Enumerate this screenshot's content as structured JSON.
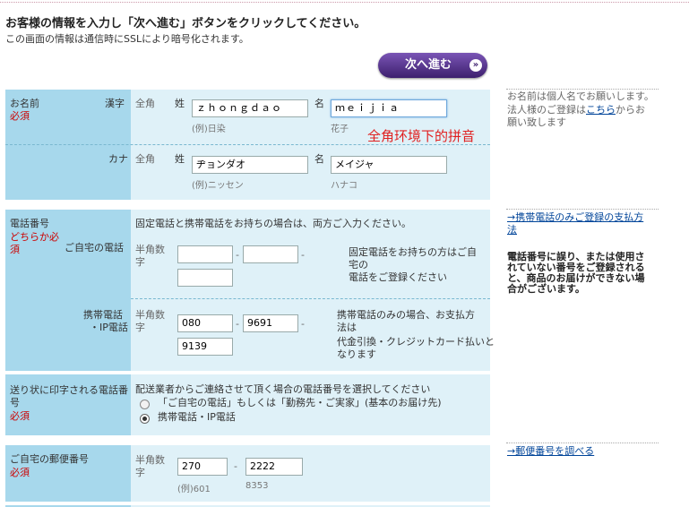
{
  "header": {
    "title": "お客様の情報を入力し「次へ進む」ボタンをクリックしてください。",
    "ssl_note": "この画面の情報は通信時にSSLにより暗号化されます。",
    "next_button": "次へ進む"
  },
  "name_section": {
    "label": "お名前",
    "required": "必須",
    "kanji": {
      "row_label": "漢字",
      "type_label": "全角",
      "sei_label": "姓",
      "sei_value": "ｚｈｏｎｇｄａｏ",
      "sei_example": "(例)日染",
      "mei_label": "名",
      "mei_value": "ｍｅｉｊｉａ",
      "mei_example": "花子"
    },
    "annotation": "全角环境下的拼音",
    "kana": {
      "row_label": "カナ",
      "type_label": "全角",
      "sei_label": "姓",
      "sei_value": "ヂョンダオ",
      "sei_example": "(例)ニッセン",
      "mei_label": "名",
      "mei_value": "メイジャ",
      "mei_example": "ハナコ"
    }
  },
  "name_note": {
    "line1": "お名前は個人名でお願いします。",
    "line2_prefix": "法人様のご登録は",
    "line2_link": "こちら",
    "line2_suffix": "からお",
    "line3": "願い致します"
  },
  "phone_section": {
    "label": "電話番号",
    "required_1": "どちらか必",
    "required_2": "須",
    "intro": "固定電話と携帯電話をお持ちの場合は、両方ご入力ください。",
    "home": {
      "label": "ご自宅の電話",
      "type_1": "半角数",
      "type_2": "字",
      "part1": "",
      "part2": "",
      "part3": "",
      "note_1": "固定電話をお持ちの方はご自",
      "note_2": "宅の",
      "note_3": "電話をご登録ください"
    },
    "mobile": {
      "label_1": "携帯電話",
      "label_2": "・IP電話",
      "type_1": "半角数",
      "type_2": "字",
      "part1": "080",
      "part2": "9691",
      "part3": "9139",
      "note_1": "携帯電話のみの場合、お支払方",
      "note_2": "法は",
      "note_3": "代金引換・クレジットカード払いと",
      "note_4": "なります"
    }
  },
  "phone_side": {
    "link_1": "→携帯電話のみご登録の支払方",
    "link_2": "法",
    "warn_1": "電話番号に誤り、または使用さ",
    "warn_2": "れていない番号をご登録される",
    "warn_3": "と、商品のお届けができない場",
    "warn_4": "合がございます。"
  },
  "label_phone_section": {
    "label_1": "送り状に印字される電話番",
    "label_2": "号",
    "required": "必須",
    "intro": "配送業者からご連絡させて頂く場合の電話番号を選択してください",
    "option_home": "「ご自宅の電話」もしくは「勤務先・ご実家」(基本のお届け先)",
    "option_mobile": "携帯電話・IP電話",
    "selected": "option_mobile"
  },
  "postal_section": {
    "label": "ご自宅の郵便番号",
    "required": "必須",
    "type_1": "半角数",
    "type_2": "字",
    "part1": "270",
    "part2": "2222",
    "example_1": "(例)601",
    "example_2": "8353"
  },
  "postal_side": {
    "link": "→郵便番号を調べる"
  },
  "colors": {
    "label_bg": "#a7d8ec",
    "field_bg": "#dff1f8",
    "button_bg": "#4b2c7f",
    "required_red": "#cc0000",
    "annotation_red": "#e02020",
    "link_blue": "#004499"
  }
}
